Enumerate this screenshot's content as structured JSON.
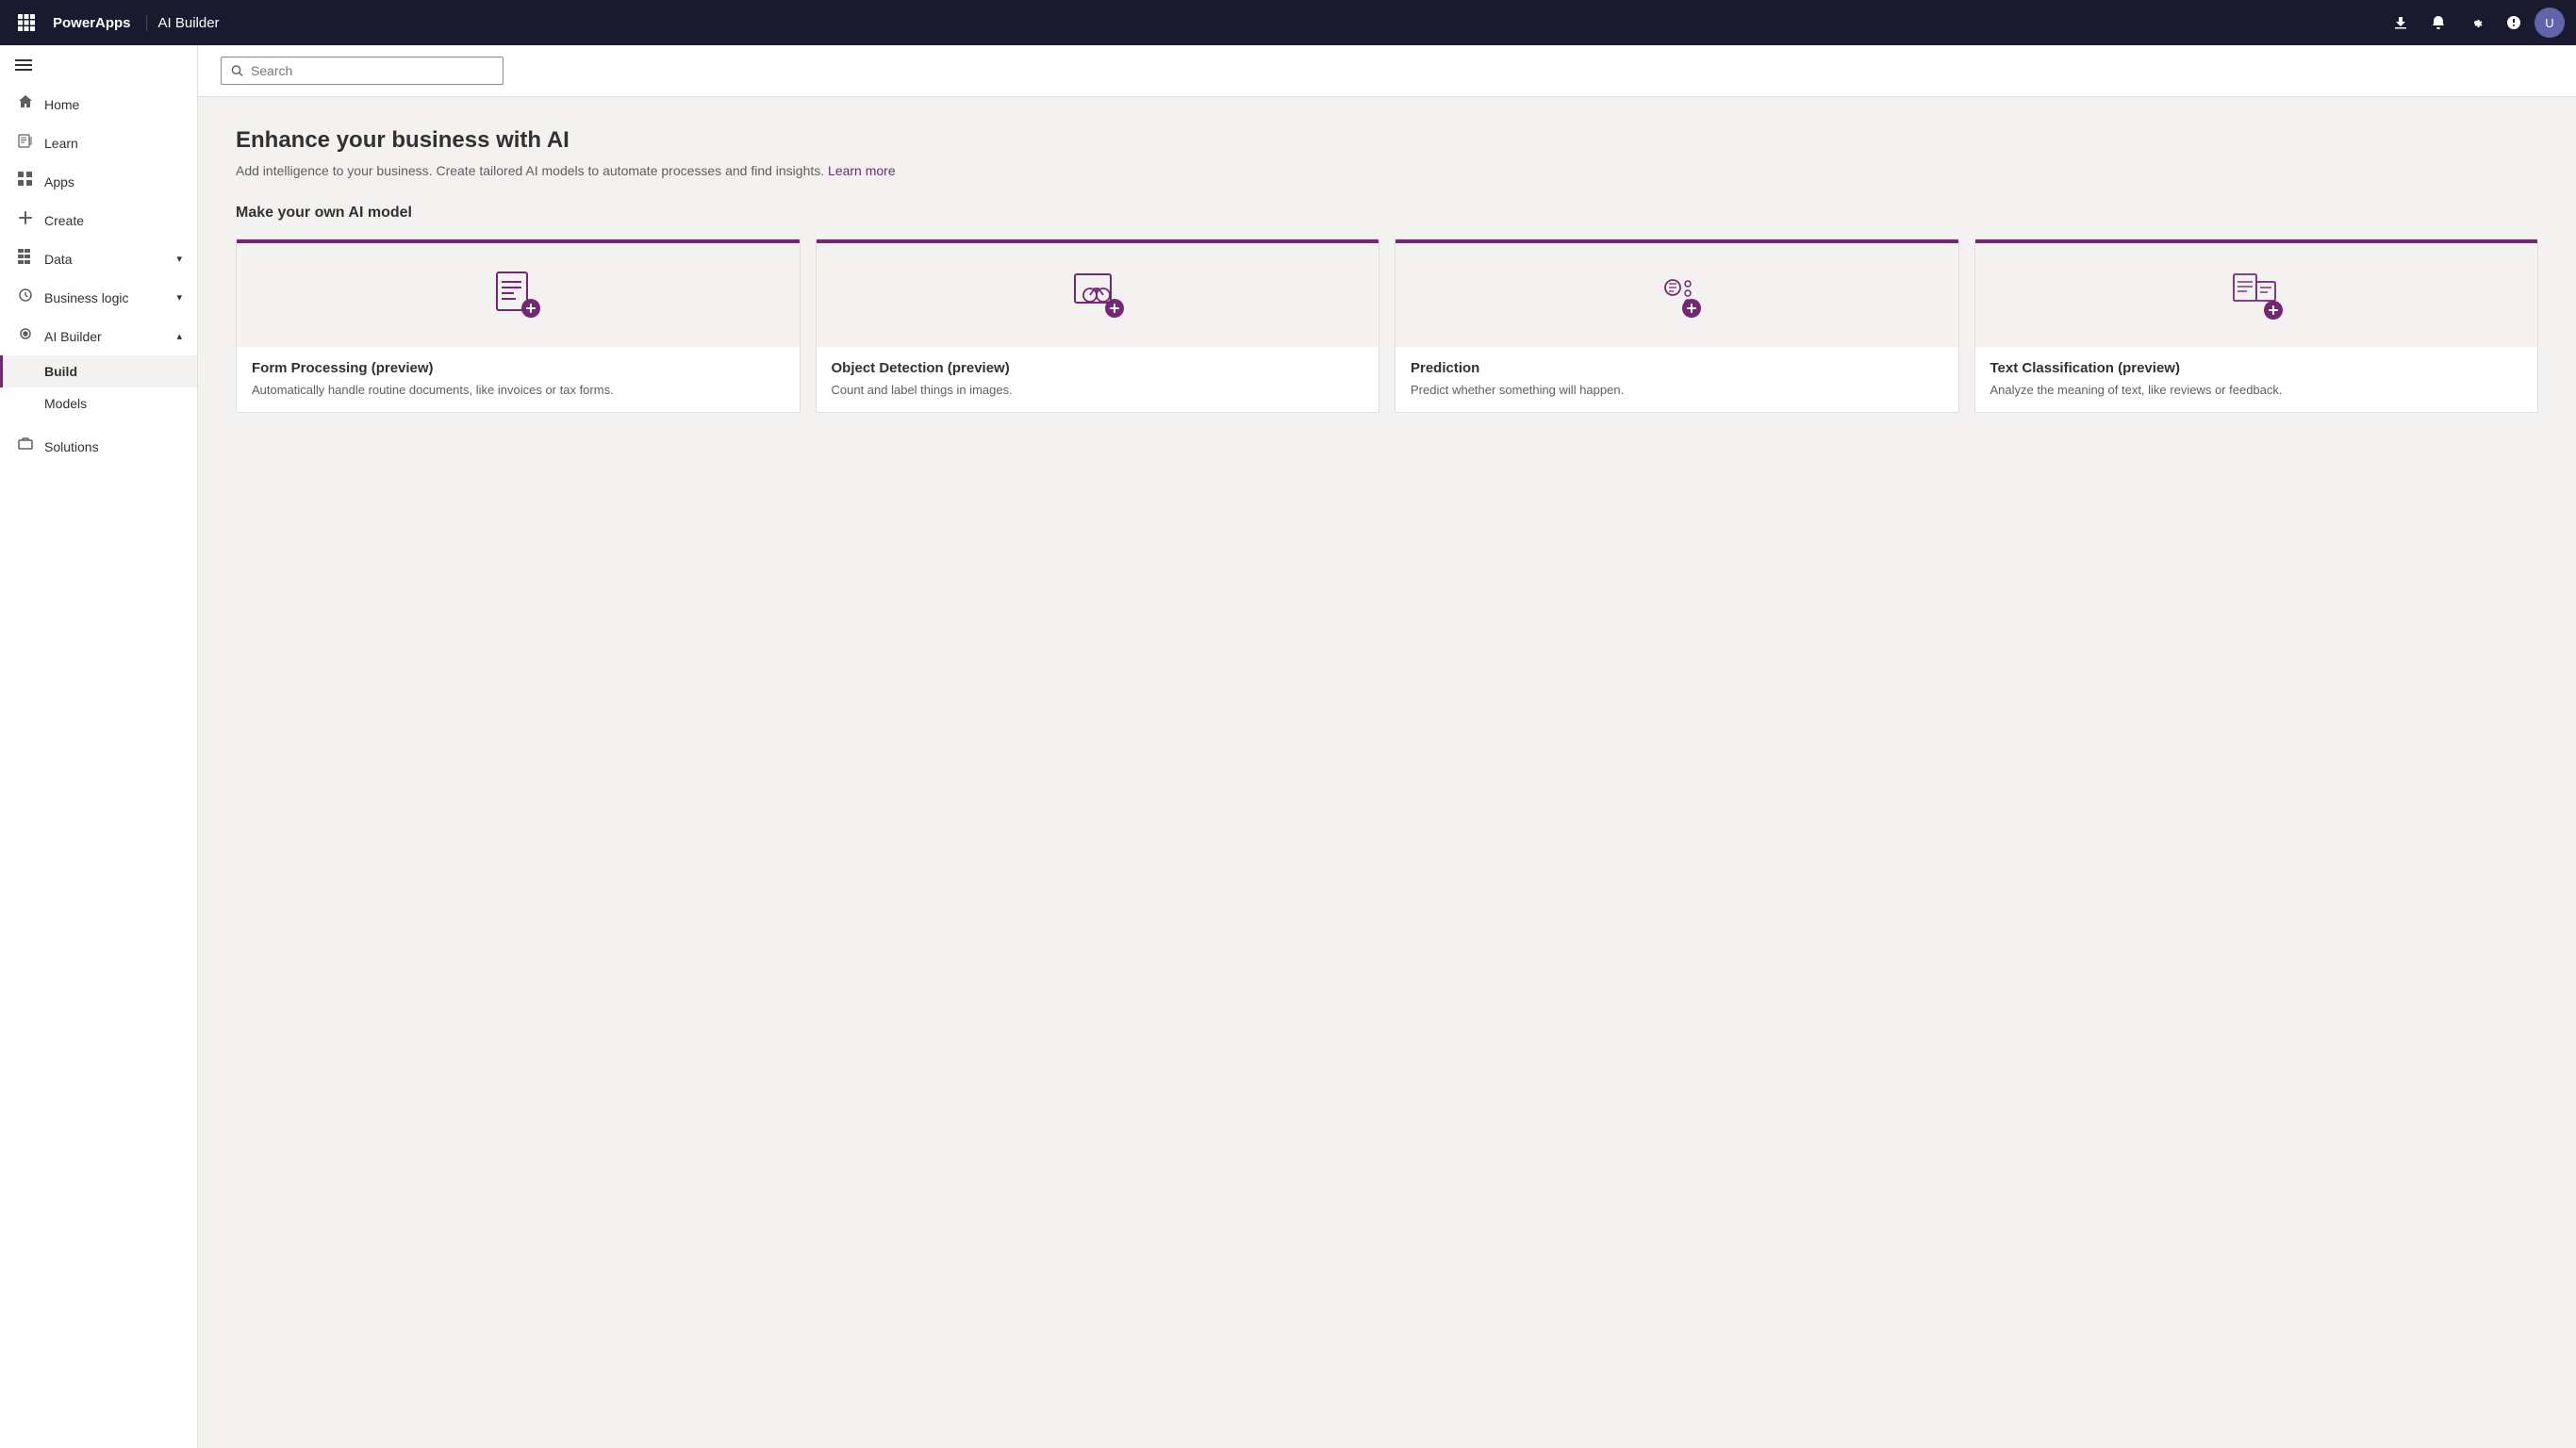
{
  "brand": "PowerApps",
  "app_name": "AI Builder",
  "top_nav": {
    "download_icon": "⬇",
    "notification_icon": "🔔",
    "settings_icon": "⚙",
    "help_icon": "?",
    "avatar_label": "U"
  },
  "sidebar": {
    "collapse_icon": "☰",
    "items": [
      {
        "id": "home",
        "label": "Home",
        "icon": "🏠",
        "active": false
      },
      {
        "id": "learn",
        "label": "Learn",
        "icon": "📖",
        "active": false
      },
      {
        "id": "apps",
        "label": "Apps",
        "icon": "⊞",
        "active": false
      },
      {
        "id": "create",
        "label": "Create",
        "icon": "＋",
        "active": false
      },
      {
        "id": "data",
        "label": "Data",
        "icon": "⊞",
        "active": false,
        "expandable": true
      },
      {
        "id": "business-logic",
        "label": "Business logic",
        "icon": "⚙",
        "active": false,
        "expandable": true
      },
      {
        "id": "ai-builder",
        "label": "AI Builder",
        "icon": "◎",
        "active": false,
        "expandable": true,
        "expanded": true
      }
    ],
    "sub_items": [
      {
        "id": "build",
        "label": "Build",
        "active": true
      },
      {
        "id": "models",
        "label": "Models",
        "active": false
      }
    ],
    "solutions": {
      "id": "solutions",
      "label": "Solutions",
      "icon": "◫"
    }
  },
  "search": {
    "placeholder": "Search"
  },
  "page": {
    "title": "Enhance your business with AI",
    "subtitle": "Add intelligence to your business. Create tailored AI models to automate processes and find insights.",
    "learn_more_label": "Learn more",
    "section_title": "Make your own AI model",
    "cards": [
      {
        "id": "form-processing",
        "title": "Form Processing (preview)",
        "description": "Automatically handle routine documents, like invoices or tax forms."
      },
      {
        "id": "object-detection",
        "title": "Object Detection (preview)",
        "description": "Count and label things in images."
      },
      {
        "id": "prediction",
        "title": "Prediction",
        "description": "Predict whether something will happen."
      },
      {
        "id": "text-classification",
        "title": "Text Classification (preview)",
        "description": "Analyze the meaning of text, like reviews or feedback."
      }
    ]
  }
}
